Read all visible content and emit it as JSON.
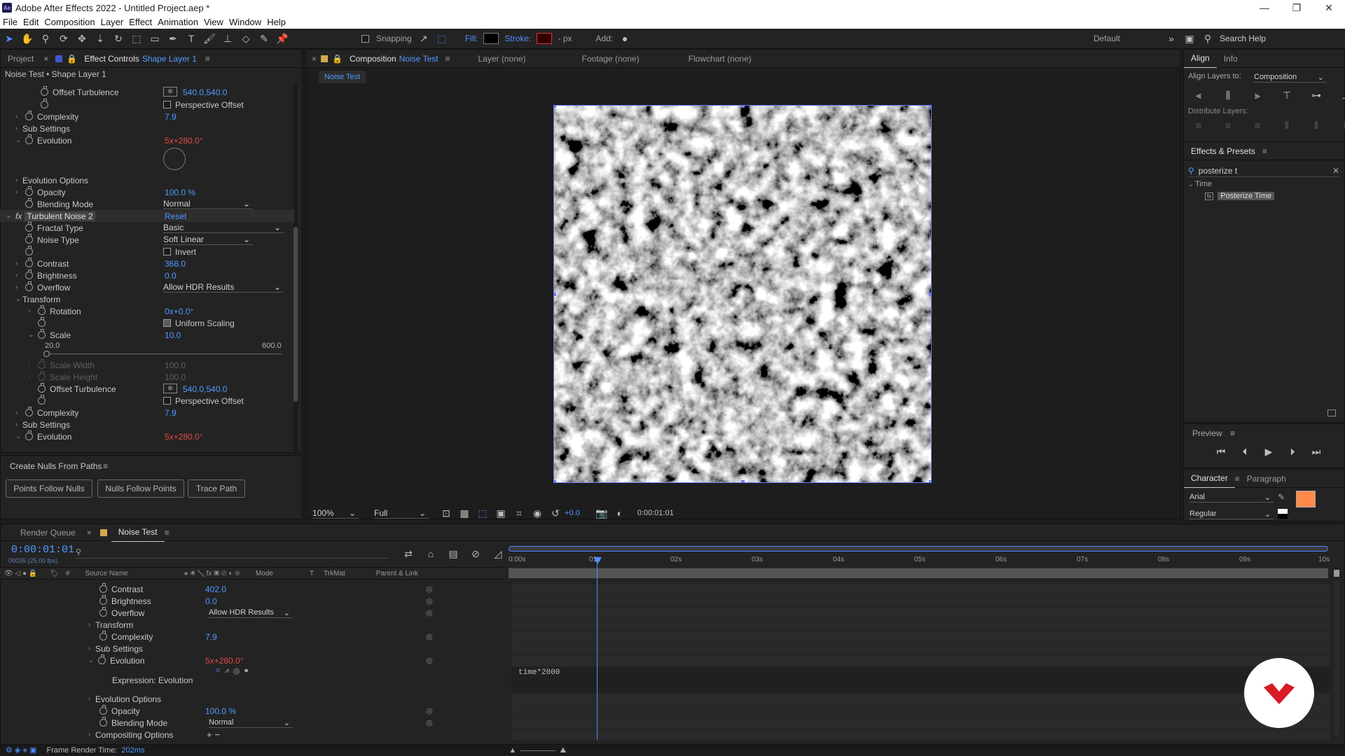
{
  "window": {
    "title": "Adobe After Effects 2022 - Untitled Project.aep *",
    "app_badge": "Ae"
  },
  "menu": [
    "File",
    "Edit",
    "Composition",
    "Layer",
    "Effect",
    "Animation",
    "View",
    "Window",
    "Help"
  ],
  "toolbar": {
    "snapping": "Snapping",
    "fill": "Fill:",
    "stroke": "Stroke:",
    "stroke_units": "- px",
    "add": "Add:",
    "workspace": "Default",
    "search_placeholder": "Search Help"
  },
  "left_panel": {
    "tabs": [
      "Project",
      "Effect Controls"
    ],
    "effect_controls_layer": "Shape Layer 1",
    "breadcrumb": "Noise Test • Shape Layer 1",
    "rows": [
      {
        "label": "Offset Turbulence",
        "value": "540.0,540.0"
      },
      {
        "label": "Perspective Offset",
        "value": ""
      },
      {
        "label": "Complexity",
        "value": "7.9"
      },
      {
        "label": "Sub Settings",
        "value": ""
      },
      {
        "label": "Evolution",
        "value": "5x+280.0°"
      },
      {
        "label": "Evolution Options",
        "value": ""
      },
      {
        "label": "Opacity",
        "value": "100.0 %"
      },
      {
        "label": "Blending Mode",
        "value": "Normal"
      },
      {
        "label": "Turbulent Noise 2",
        "value": "Reset"
      },
      {
        "label": "Fractal Type",
        "value": "Basic"
      },
      {
        "label": "Noise Type",
        "value": "Soft Linear"
      },
      {
        "label": "Invert",
        "value": ""
      },
      {
        "label": "Contrast",
        "value": "368.0"
      },
      {
        "label": "Brightness",
        "value": "0.0"
      },
      {
        "label": "Overflow",
        "value": "Allow HDR Results"
      },
      {
        "label": "Transform",
        "value": ""
      },
      {
        "label": "Rotation",
        "value": "0x+0.0°"
      },
      {
        "label": "Uniform Scaling",
        "value": ""
      },
      {
        "label": "Scale",
        "value": "10.0"
      },
      {
        "label": "Scale Width",
        "value": "100.0"
      },
      {
        "label": "Scale Height",
        "value": "100.0"
      },
      {
        "label": "Offset Turbulence",
        "value": "540.0,540.0"
      },
      {
        "label": "Perspective Offset",
        "value": ""
      },
      {
        "label": "Complexity",
        "value": "7.9"
      },
      {
        "label": "Sub Settings",
        "value": ""
      },
      {
        "label": "Evolution",
        "value": "5x+280.0°"
      }
    ],
    "slider_min": "20.0",
    "slider_max": "600.0",
    "nulls_panel": {
      "title": "Create Nulls From Paths",
      "buttons": [
        "Points Follow Nulls",
        "Nulls Follow Points",
        "Trace Path"
      ]
    }
  },
  "composition": {
    "tabs": [
      "Composition",
      "Layer (none)",
      "Footage (none)",
      "Flowchart (none)"
    ],
    "comp_name": "Noise Test",
    "zoom": "100%",
    "resolution": "Full",
    "exposure": "+0.0",
    "timecode": "0:00:01:01"
  },
  "right_panel": {
    "align_tabs": [
      "Align",
      "Info"
    ],
    "align_layers_to_label": "Align Layers to:",
    "align_layers_to_value": "Composition",
    "distribute_label": "Distribute Layers:",
    "effects_title": "Effects & Presets",
    "effects_search": "posterize t",
    "effects_category": "Time",
    "effects_item": "Posterize Time",
    "preview_title": "Preview",
    "character_tabs": [
      "Character",
      "Paragraph"
    ],
    "font": "Arial",
    "font_style": "Regular",
    "fill_color": "#ff8a4c"
  },
  "timeline": {
    "tabs": [
      "Render Queue",
      "Noise Test"
    ],
    "timecode": "0:00:01:01",
    "frame_info": "00026 (25.00 fps)",
    "columns": [
      "#",
      "Source Name",
      "Mode",
      "T",
      "TrkMat",
      "Parent & Link"
    ],
    "ruler": [
      "0:00s",
      "01s",
      "02s",
      "03s",
      "04s",
      "05s",
      "06s",
      "07s",
      "08s",
      "09s",
      "10s"
    ],
    "rows": [
      {
        "label": "Contrast",
        "value": "402.0"
      },
      {
        "label": "Brightness",
        "value": "0.0"
      },
      {
        "label": "Overflow",
        "value": "Allow HDR Results"
      },
      {
        "label": "Transform",
        "value": ""
      },
      {
        "label": "Complexity",
        "value": "7.9"
      },
      {
        "label": "Sub Settings",
        "value": ""
      },
      {
        "label": "Evolution",
        "value": "5x+280.0°"
      },
      {
        "label": "Expression: Evolution",
        "value": ""
      },
      {
        "label": "Evolution Options",
        "value": ""
      },
      {
        "label": "Opacity",
        "value": "100.0 %"
      },
      {
        "label": "Blending Mode",
        "value": "Normal"
      },
      {
        "label": "Compositing Options",
        "value": ""
      }
    ],
    "expression": "time*2000",
    "status_label": "Frame Render Time:",
    "status_value": "202ms"
  }
}
